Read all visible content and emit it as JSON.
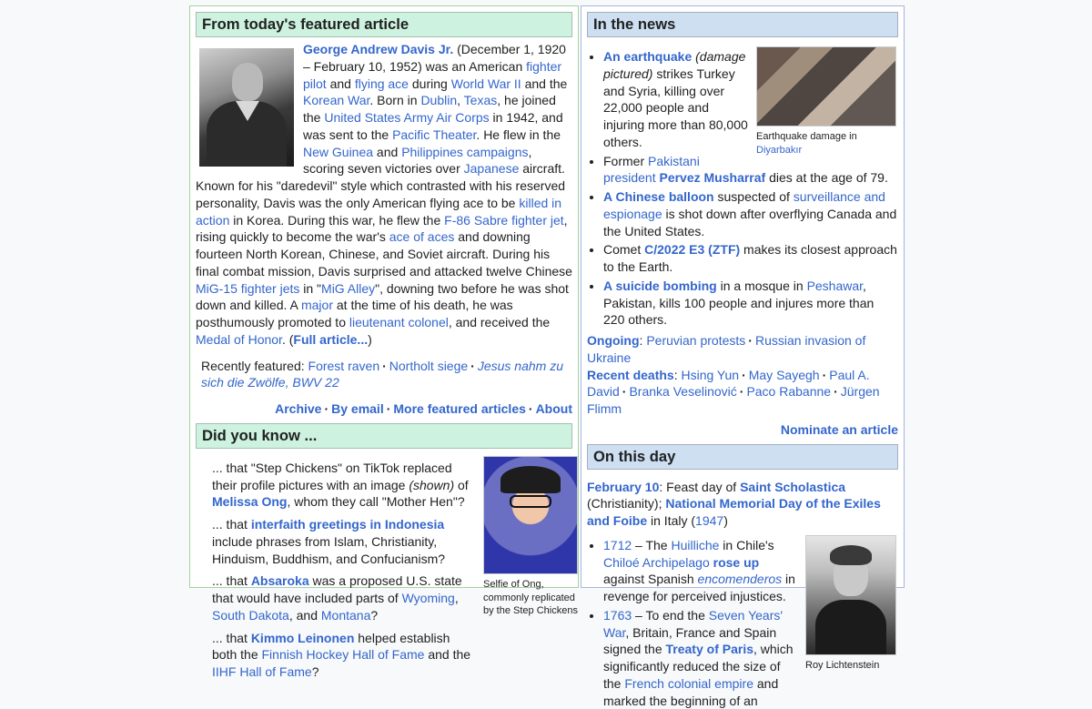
{
  "tfa": {
    "heading": "From today's featured article",
    "p1": "George Andrew Davis Jr.",
    "p2": " (December 1, 1920 – February 10, 1952) was an American ",
    "l_fighter_pilot": "fighter pilot",
    "t_and": " and ",
    "l_flying_ace": "flying ace",
    "t_during": " during ",
    "l_ww2": "World War II",
    "t_and_the": " and the ",
    "l_korean": "Korean War",
    "t_born": ". Born in ",
    "l_dublin": "Dublin",
    "t_comma": ", ",
    "l_texas": "Texas",
    "t_joined": ", he joined the ",
    "l_usaac": "United States Army Air Corps",
    "t_1942": " in 1942, and was sent to the ",
    "l_pacific": "Pacific Theater",
    "t_flew": ". He flew in the ",
    "l_ng": "New Guinea",
    "t_and2": " and ",
    "l_phil": "Philippines campaigns",
    "t_scoring": ", scoring seven victories over ",
    "l_japanese": "Japanese",
    "t_known": " aircraft. Known for his \"daredevil\" style which contrasted with his reserved personality, Davis was the only American flying ace to be ",
    "l_kia": "killed in action",
    "t_korea": " in Korea. During this war, he flew the ",
    "l_f86": "F-86 Sabre fighter jet",
    "t_rising": ", rising quickly to become the war's ",
    "l_aoa": "ace of aces",
    "t_downing": " and downing fourteen North Korean, Chinese, and Soviet aircraft. During his final combat mission, Davis surprised and attacked twelve Chinese ",
    "l_mig15": "MiG-15 fighter jets",
    "t_in": " in \"",
    "l_migalley": "MiG Alley",
    "t_downing2": "\", downing two before he was shot down and killed. A ",
    "l_major": "major",
    "t_time": " at the time of his death, he was posthumously promoted to ",
    "l_ltcol": "lieutenant colonel",
    "t_received": ", and received the ",
    "l_moh": "Medal of Honor",
    "t_dot": ". (",
    "l_full": "Full article...",
    "t_close": ")",
    "recent_label": "Recently featured: ",
    "recent": [
      "Forest raven",
      "Northolt siege",
      "Jesus nahm zu sich die Zwölfe, BWV 22"
    ],
    "foot": [
      "Archive",
      "By email",
      "More featured articles",
      "About"
    ]
  },
  "dyk": {
    "heading": "Did you know ...",
    "caption": "Selfie of Ong, commonly replicated by the Step Chickens",
    "i1a": "... that \"Step Chickens\" on TikTok replaced their profile pictures with an image ",
    "i1b": "(shown)",
    "i1c": " of ",
    "i1l": "Melissa Ong",
    "i1d": ", whom they call \"Mother Hen\"?",
    "i2a": "... that ",
    "i2l": "interfaith greetings in Indonesia",
    "i2b": " include phrases from Islam, Christianity, Hinduism, Buddhism, and Confucianism?",
    "i3a": "... that ",
    "i3l": "Absaroka",
    "i3b": " was a proposed U.S. state that would have included parts of ",
    "i3l2": "Wyoming",
    "i3c": ", ",
    "i3l3": "South Dakota",
    "i3d": ", and ",
    "i3l4": "Montana",
    "i3e": "?",
    "i4a": "... that ",
    "i4l": "Kimmo Leinonen",
    "i4b": " helped establish both the ",
    "i4l2": "Finnish Hockey Hall of Fame",
    "i4c": " and the ",
    "i4l3": "IIHF Hall of Fame",
    "i4d": "?"
  },
  "itn": {
    "heading": "In the news",
    "caption_a": "Earthquake damage in ",
    "caption_l": "Diyarbakır",
    "n1l": "An earthquake",
    "n1a": " (damage pictured)",
    "n1b": " strikes Turkey and Syria, killing over 22,000 people and injuring more than 80,000 others.",
    "n2a": "Former ",
    "n2l": "Pakistani president",
    "n2l2": "Pervez Musharraf",
    "n2b": " dies at the age of 79.",
    "n3l": "A Chinese balloon",
    "n3a": " suspected of ",
    "n3l2": "surveillance and espionage",
    "n3b": " is shot down after overflying Canada and the United States.",
    "n4a": "Comet ",
    "n4l": "C/2022 E3 (ZTF)",
    "n4b": " makes its closest approach to the Earth.",
    "n5l": "A suicide bombing",
    "n5a": " in a mosque in ",
    "n5l2": "Peshawar",
    "n5b": ", Pakistan, kills 100 people and injures more than 220 others.",
    "ongoing_label": "Ongoing",
    "ongoing": [
      "Peruvian protests",
      "Russian invasion of Ukraine"
    ],
    "deaths_label": "Recent deaths",
    "deaths": [
      "Hsing Yun",
      "May Sayegh",
      "Paul A. David",
      "Branka Veselinović",
      "Paco Rabanne",
      "Jürgen Flimm"
    ],
    "nominate": "Nominate an article"
  },
  "otd": {
    "heading": "On this day",
    "date": "February 10",
    "d_a": ": Feast day of ",
    "d_l": "Saint Scholastica",
    "d_b": " (Christianity);",
    "d_l2": "National Memorial Day of the Exiles and Foibe",
    "d_c": " in Italy (",
    "d_l3": "1947",
    "d_d": ")",
    "caption": "Roy Lichtenstein",
    "e1y": "1712",
    "e1a": " – The ",
    "e1l": "Huilliche",
    "e1b": " in Chile's ",
    "e1l2": "Chiloé Archipelago",
    "e1c": " ",
    "e1l3": "rose up",
    "e1d": " against Spanish ",
    "e1l4": "encomenderos",
    "e1e": " in revenge for perceived injustices.",
    "e2y": "1763",
    "e2a": " – To end the ",
    "e2l": "Seven Years' War",
    "e2b": ", Britain, France and Spain signed the ",
    "e2l2": "Treaty of Paris",
    "e2c": ", which significantly reduced the size of the ",
    "e2l3": "French colonial empire",
    "e2d": " and marked the beginning of an"
  }
}
